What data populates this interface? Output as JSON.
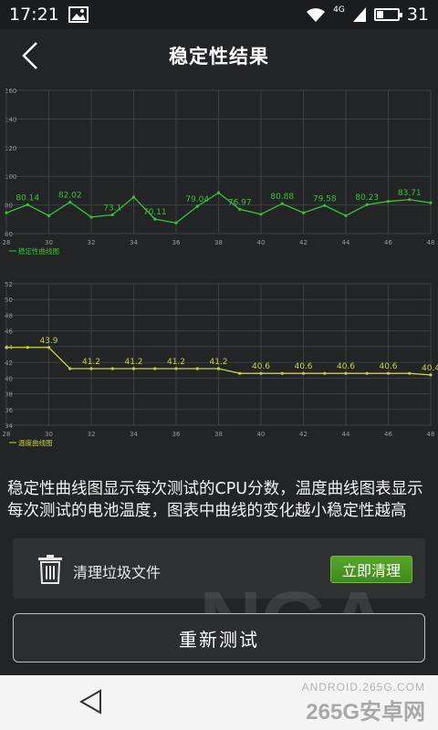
{
  "status_bar": {
    "time": "17:21",
    "network_label": "4G",
    "battery_level": "31",
    "icons": [
      "image-icon",
      "wifi-icon",
      "signal-icon",
      "battery-icon"
    ]
  },
  "header": {
    "title": "稳定性结果"
  },
  "chart_data": [
    {
      "type": "line",
      "title": "",
      "xlabel": "",
      "ylabel": "",
      "ylim": [
        60,
        160
      ],
      "yticks": [
        60,
        80,
        100,
        120,
        140,
        160
      ],
      "xlim": [
        28,
        48
      ],
      "xticks": [
        28,
        30,
        32,
        34,
        36,
        38,
        40,
        42,
        44,
        46,
        48
      ],
      "grid": true,
      "legend": "bottom-left",
      "color": "#35c435",
      "series": [
        {
          "name": "稳定性曲线图",
          "x": [
            28,
            29,
            30,
            31,
            32,
            33,
            34,
            35,
            36,
            37,
            38,
            39,
            40,
            41,
            42,
            43,
            44,
            45,
            46,
            47,
            48
          ],
          "y": [
            74.5,
            80.14,
            72.5,
            82.02,
            71.5,
            73.1,
            85.5,
            70.11,
            67.5,
            79.04,
            88.5,
            76.97,
            73.5,
            80.88,
            74.5,
            79.58,
            72.5,
            80.23,
            82.5,
            83.71,
            81.5
          ],
          "labels": {
            "29": "80.14",
            "31": "82.02",
            "33": "73.1",
            "35": "70.11",
            "37": "79.04",
            "39": "76.97",
            "41": "80.88",
            "43": "79.58",
            "45": "80.23",
            "47": "83.71"
          }
        }
      ]
    },
    {
      "type": "line",
      "title": "",
      "xlabel": "",
      "ylabel": "",
      "ylim": [
        34,
        52
      ],
      "yticks": [
        34,
        36,
        38,
        40,
        42,
        44,
        46,
        48,
        50,
        52
      ],
      "xlim": [
        28,
        48
      ],
      "xticks": [
        28,
        30,
        32,
        34,
        36,
        38,
        40,
        42,
        44,
        46,
        48
      ],
      "grid": true,
      "legend": "bottom-left",
      "color": "#c8d33a",
      "series": [
        {
          "name": "温度曲线图",
          "x": [
            28,
            29,
            30,
            31,
            32,
            33,
            34,
            35,
            36,
            37,
            38,
            39,
            40,
            41,
            42,
            43,
            44,
            45,
            46,
            47,
            48
          ],
          "y": [
            43.9,
            43.9,
            43.9,
            41.2,
            41.2,
            41.2,
            41.2,
            41.2,
            41.2,
            41.2,
            41.2,
            40.6,
            40.6,
            40.6,
            40.6,
            40.6,
            40.6,
            40.6,
            40.6,
            40.6,
            40.4
          ],
          "labels": {
            "30": "43.9",
            "32": "41.2",
            "34": "41.2",
            "36": "41.2",
            "38": "41.2",
            "40": "40.6",
            "42": "40.6",
            "44": "40.6",
            "46": "40.6",
            "48": "40.4"
          }
        }
      ]
    }
  ],
  "description": {
    "text": "稳定性曲线图显示每次测试的CPU分数，温度曲线图表显示每次测试的电池温度，图表中曲线的变化越小稳定性越高"
  },
  "clean_card": {
    "label": "清理垃圾文件",
    "button_label": "立即清理"
  },
  "actions": {
    "retest_label": "重新测试"
  },
  "watermark": {
    "text": "NGA"
  },
  "site_tag": {
    "url": "ANDROID.265G.COM",
    "name": "265G安卓网"
  },
  "colors": {
    "background": "#232426",
    "cpu_line": "#35c435",
    "temp_line": "#c8d33a",
    "button_green": "#4a9a22"
  }
}
